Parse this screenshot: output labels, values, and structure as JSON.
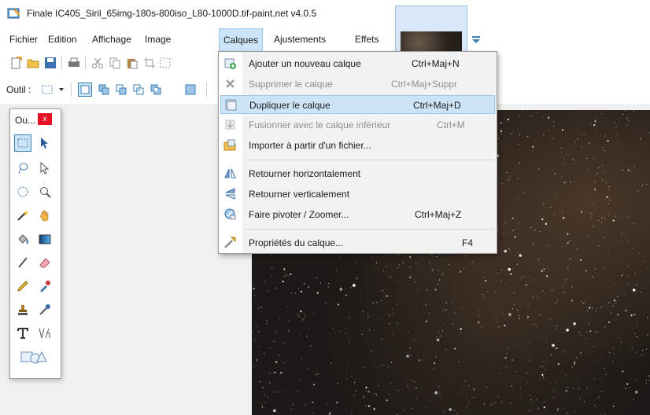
{
  "window": {
    "title": "Finale IC405_Siril_65img-180s-800iso_L80-1000D.tif-paint.net v4.0.5"
  },
  "menubar": {
    "items": [
      {
        "label": "Fichier"
      },
      {
        "label": "Edition"
      },
      {
        "label": "Affichage"
      },
      {
        "label": "Image"
      },
      {
        "label": "Calques"
      },
      {
        "label": "Ajustements"
      },
      {
        "label": "Effets"
      }
    ]
  },
  "toolbar2": {
    "tool_label": "Outil :"
  },
  "tools_window": {
    "title": "Ou...",
    "close_label": "x"
  },
  "layers_menu": {
    "items": [
      {
        "label": "Ajouter un nouveau calque",
        "shortcut": "Ctrl+Maj+N",
        "icon": "add-layer-icon",
        "enabled": true
      },
      {
        "label": "Supprimer le calque",
        "shortcut": "Ctrl+Maj+Suppr",
        "icon": "delete-layer-icon",
        "enabled": false
      },
      {
        "label": "Dupliquer le calque",
        "shortcut": "Ctrl+Maj+D",
        "icon": "duplicate-layer-icon",
        "enabled": true,
        "highlighted": true
      },
      {
        "label": "Fusionner avec le calque inférieur",
        "shortcut": "Ctrl+M",
        "icon": "merge-down-icon",
        "enabled": false
      },
      {
        "label": "Importer à partir d'un fichier...",
        "shortcut": "",
        "icon": "import-file-icon",
        "enabled": true
      },
      {
        "label": "Retourner horizontalement",
        "shortcut": "",
        "icon": "flip-horizontal-icon",
        "enabled": true
      },
      {
        "label": "Retourner verticalement",
        "shortcut": "",
        "icon": "flip-vertical-icon",
        "enabled": true
      },
      {
        "label": "Faire pivoter / Zoomer...",
        "shortcut": "Ctrl+Maj+Z",
        "icon": "rotate-zoom-icon",
        "enabled": true
      },
      {
        "label": "Propriétés du calque...",
        "shortcut": "F4",
        "icon": "layer-properties-icon",
        "enabled": true
      }
    ]
  },
  "colors": {
    "menu_highlight": "#cce4f7",
    "menu_highlight_border": "#99c9ef",
    "close_button": "#e81123",
    "sky": "#1d1916"
  }
}
